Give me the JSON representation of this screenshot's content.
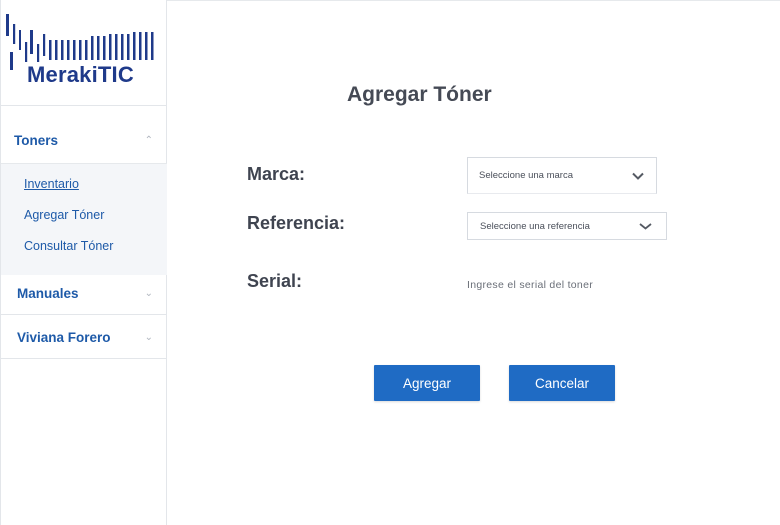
{
  "brand": {
    "name": "MerakiTIC",
    "color": "#1f3a8a",
    "logo_icon": "barcode-icon"
  },
  "sidebar": {
    "sections": [
      {
        "label": "Toners",
        "expanded": true,
        "items": [
          {
            "label": "Inventario",
            "active": true
          },
          {
            "label": "Agregar Tóner",
            "active": false
          },
          {
            "label": "Consultar Tóner",
            "active": false
          }
        ]
      },
      {
        "label": "Manuales",
        "expanded": false
      },
      {
        "label": "Viviana Forero",
        "expanded": false
      }
    ]
  },
  "form": {
    "title": "Agregar Tóner",
    "marca": {
      "label": "Marca:",
      "placeholder": "Seleccione una marca"
    },
    "referencia": {
      "label": "Referencia:",
      "placeholder": "Seleccione una referencia"
    },
    "serial": {
      "label": "Serial:",
      "placeholder": "Ingrese el serial del toner",
      "value": ""
    },
    "buttons": {
      "add": "Agregar",
      "cancel": "Cancelar"
    }
  },
  "colors": {
    "accent": "#1f6bc4",
    "nav_text": "#1e5aa8",
    "sidebar_sub_bg": "#f4f6f9"
  }
}
